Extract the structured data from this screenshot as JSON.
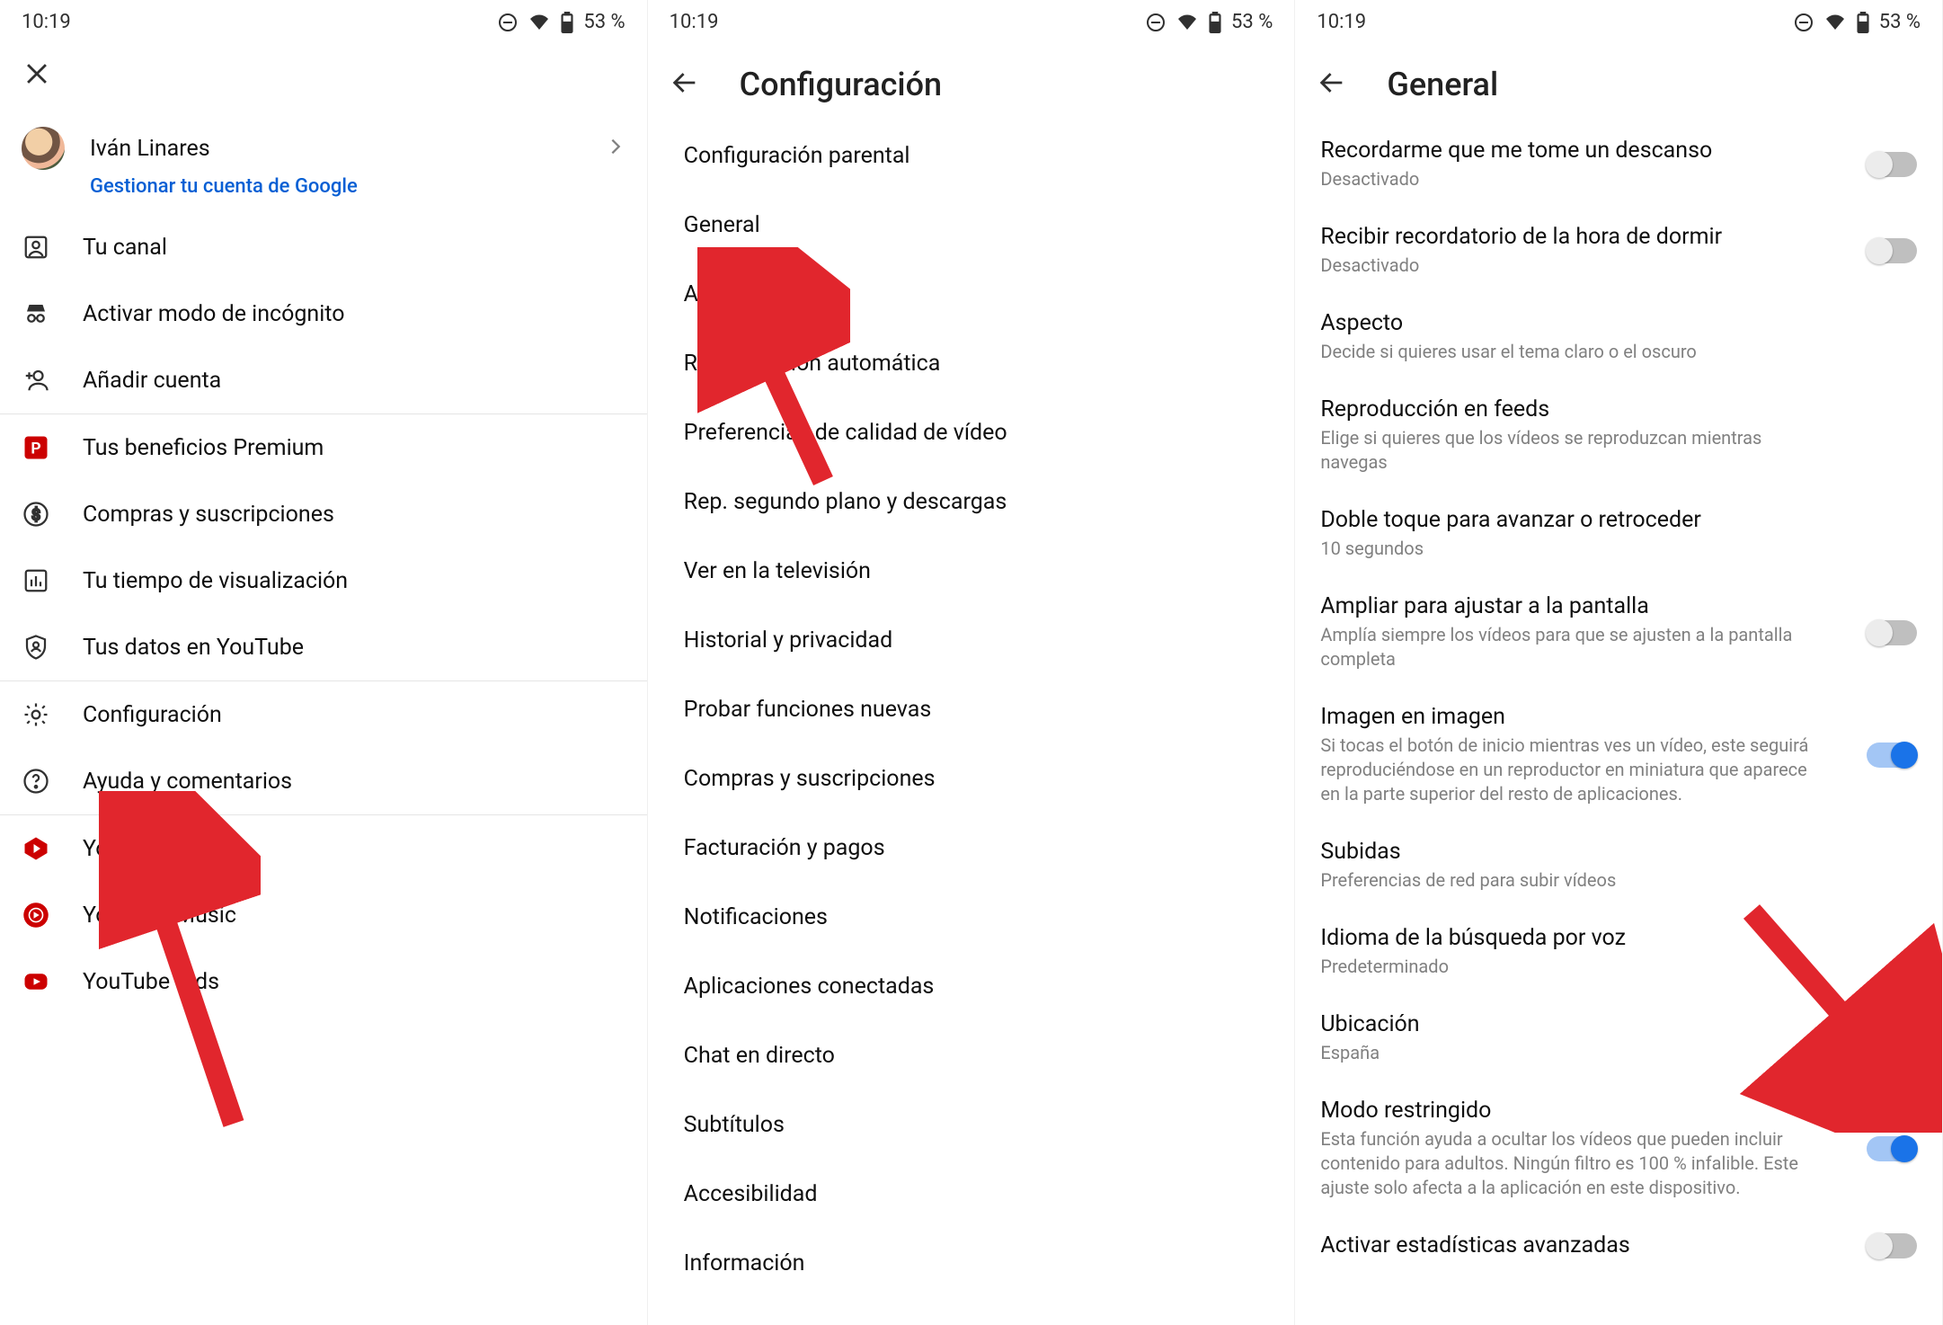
{
  "status": {
    "time": "10:19",
    "battery": "53 %"
  },
  "screen1": {
    "profile_name": "Iván Linares",
    "manage_account": "Gestionar tu cuenta de Google",
    "items": [
      "Tu canal",
      "Activar modo de incógnito",
      "Añadir cuenta",
      "Tus beneficios Premium",
      "Compras y suscripciones",
      "Tu tiempo de visualización",
      "Tus datos en YouTube",
      "Configuración",
      "Ayuda y comentarios",
      "YouTube Studio",
      "YouTube Music",
      "YouTube Kids"
    ]
  },
  "screen2": {
    "title": "Configuración",
    "items": [
      "Configuración parental",
      "General",
      "Ahorro de datos",
      "Reproducción automática",
      "Preferencias de calidad de vídeo",
      "Rep. segundo plano y descargas",
      "Ver en la televisión",
      "Historial y privacidad",
      "Probar funciones nuevas",
      "Compras y suscripciones",
      "Facturación y pagos",
      "Notificaciones",
      "Aplicaciones conectadas",
      "Chat en directo",
      "Subtítulos",
      "Accesibilidad",
      "Información"
    ]
  },
  "screen3": {
    "title": "General",
    "settings": [
      {
        "title": "Recordarme que me tome un descanso",
        "sub": "Desactivado",
        "toggle": "off"
      },
      {
        "title": "Recibir recordatorio de la hora de dormir",
        "sub": "Desactivado",
        "toggle": "off"
      },
      {
        "title": "Aspecto",
        "sub": "Decide si quieres usar el tema claro o el oscuro"
      },
      {
        "title": "Reproducción en feeds",
        "sub": "Elige si quieres que los vídeos se reproduzcan mientras navegas"
      },
      {
        "title": "Doble toque para avanzar o retroceder",
        "sub": "10 segundos"
      },
      {
        "title": "Ampliar para ajustar a la pantalla",
        "sub": "Amplía siempre los vídeos para que se ajusten a la pantalla completa",
        "toggle": "off"
      },
      {
        "title": "Imagen en imagen",
        "sub": "Si tocas el botón de inicio mientras ves un vídeo, este seguirá reproduciéndose en un reproductor en miniatura que aparece en la parte superior del resto de aplicaciones.",
        "toggle": "on"
      },
      {
        "title": "Subidas",
        "sub": "Preferencias de red para subir vídeos"
      },
      {
        "title": "Idioma de la búsqueda por voz",
        "sub": "Predeterminado"
      },
      {
        "title": "Ubicación",
        "sub": "España"
      },
      {
        "title": "Modo restringido",
        "sub": "Esta función ayuda a ocultar los vídeos que pueden incluir contenido para adultos. Ningún filtro es 100 % infalible. Este ajuste solo afecta a la aplicación en este dispositivo.",
        "toggle": "on"
      },
      {
        "title": "Activar estadísticas avanzadas",
        "toggle": "off"
      }
    ]
  }
}
